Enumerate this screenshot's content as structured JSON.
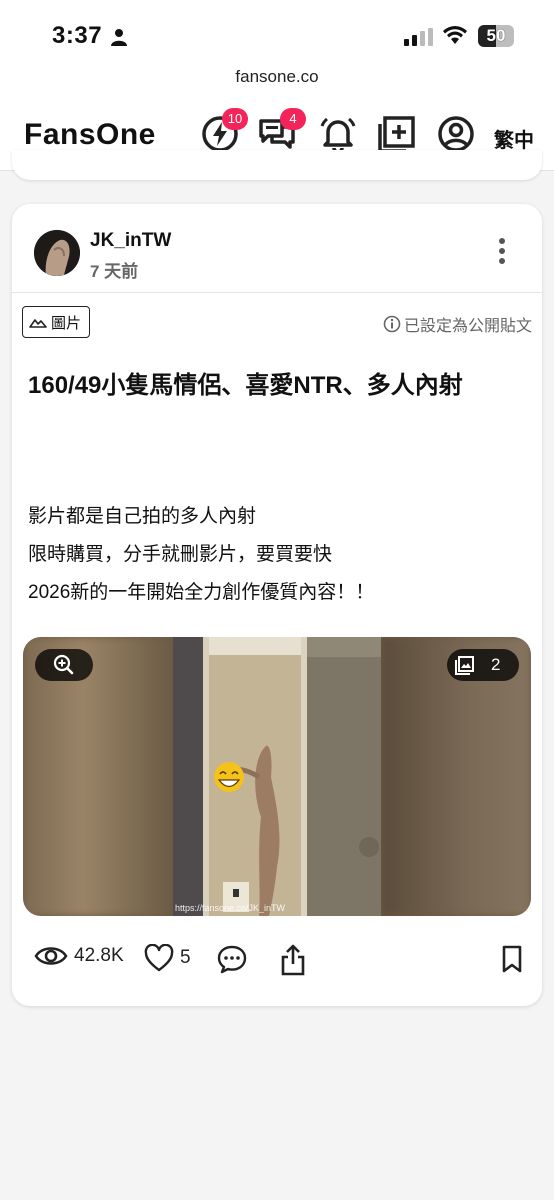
{
  "status_bar": {
    "time": "3:37",
    "battery": "50"
  },
  "browser": {
    "url": "fansone.co"
  },
  "header": {
    "brand": "FansOne",
    "lightning_badge": "10",
    "messages_badge": "4",
    "language": "繁中",
    "accent_color": "#f2245a"
  },
  "post": {
    "username": "JK_inTW",
    "time_ago": "7 天前",
    "type_tag": "圖片",
    "visibility": "已設定為公開貼文",
    "title": "160/49小隻馬情侶、喜愛NTR、多人內射",
    "body_lines": [
      "影片都是自己拍的多人內射",
      "限時購買，分手就刪影片，要買要快",
      "2026新的一年開始全力創作優質內容！！"
    ],
    "media": {
      "image_count": "2",
      "watermark": "https://fansone.co/JK_inTW"
    },
    "stats": {
      "views": "42.8K",
      "likes": "5"
    }
  }
}
